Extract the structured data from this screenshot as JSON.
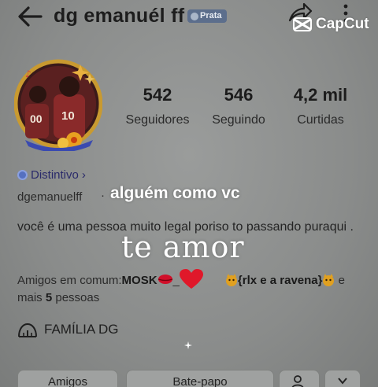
{
  "header": {
    "username": "dg emanuél  ff",
    "badge": "Prata"
  },
  "watermark": {
    "text": "CapCut"
  },
  "profile": {
    "stats": [
      {
        "value": "542",
        "label": "Seguidores"
      },
      {
        "value": "546",
        "label": "Seguindo"
      },
      {
        "value": "4,2 mil",
        "label": "Curtidas"
      }
    ],
    "distintivo": "Distintivo",
    "handle": "dgemanuelff",
    "bio": "você é uma pessoa muito legal poriso to passando puraqui .",
    "friends": {
      "prefix": "Amigos em comum:",
      "name1": "MOSK",
      "sep": "_",
      "name2": "{rlx e a ravena}",
      "suffix_1": "e mais",
      "count": "5",
      "suffix_2": "pessoas"
    },
    "family": "FAMÍLIA DG"
  },
  "overlays": {
    "line1": "alguém como vc",
    "line2": "te amor"
  },
  "buttons": [
    {
      "label": "Amigos"
    },
    {
      "label": "Bate-papo"
    }
  ],
  "icons": {
    "back": "arrow-left-icon",
    "share": "share-icon",
    "more": "more-vertical-icon",
    "capcut": "capcut-logo-icon",
    "family": "family-icon"
  },
  "colors": {
    "background": "#888a89",
    "badge": "#5c6e8c",
    "avatar_ring": "#d9a63a",
    "heart": "#e0182a",
    "overlay_text": "#ffffff"
  }
}
